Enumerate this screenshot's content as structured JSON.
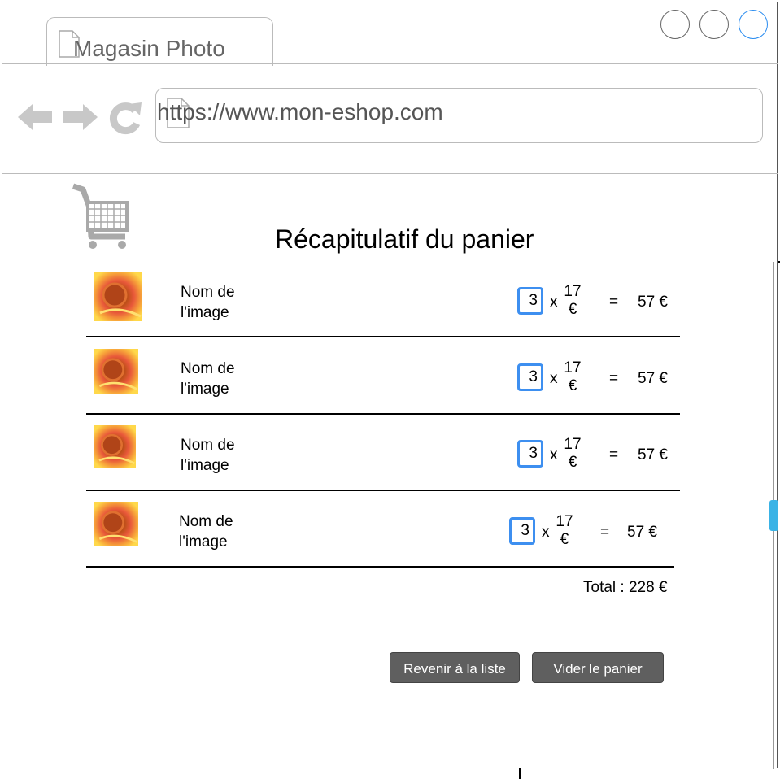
{
  "browser": {
    "tab_title": "Magasin Photo",
    "url": "https://www.mon-eshop.com"
  },
  "cart": {
    "title": "Récapitulatif du panier",
    "items": [
      {
        "name_line1": "Nom de",
        "name_line2": "l'image",
        "quantity": "3",
        "times": "x",
        "price_amount": "17",
        "price_currency": "€",
        "equals": "=",
        "line_total": "57 €"
      },
      {
        "name_line1": "Nom de",
        "name_line2": "l'image",
        "quantity": "3",
        "times": "x",
        "price_amount": "17",
        "price_currency": "€",
        "equals": "=",
        "line_total": "57 €"
      },
      {
        "name_line1": "Nom de",
        "name_line2": "l'image",
        "quantity": "3",
        "times": "x",
        "price_amount": "17",
        "price_currency": "€",
        "equals": "=",
        "line_total": "57 €"
      },
      {
        "name_line1": "Nom de",
        "name_line2": "l'image",
        "quantity": "3",
        "times": "x",
        "price_amount": "17",
        "price_currency": "€",
        "equals": "=",
        "line_total": "57 €"
      }
    ],
    "total": "Total : 228 €"
  },
  "actions": {
    "back_label": "Revenir à la liste",
    "empty_label": "Vider le panier"
  },
  "colors": {
    "accent": "#3d8ff0",
    "button_bg": "#5f5f5f",
    "scroll_thumb": "#3ab3e6"
  },
  "icons": [
    "document-icon",
    "back-arrow-icon",
    "forward-arrow-icon",
    "reload-icon",
    "cart-icon",
    "image-thumbnail"
  ]
}
